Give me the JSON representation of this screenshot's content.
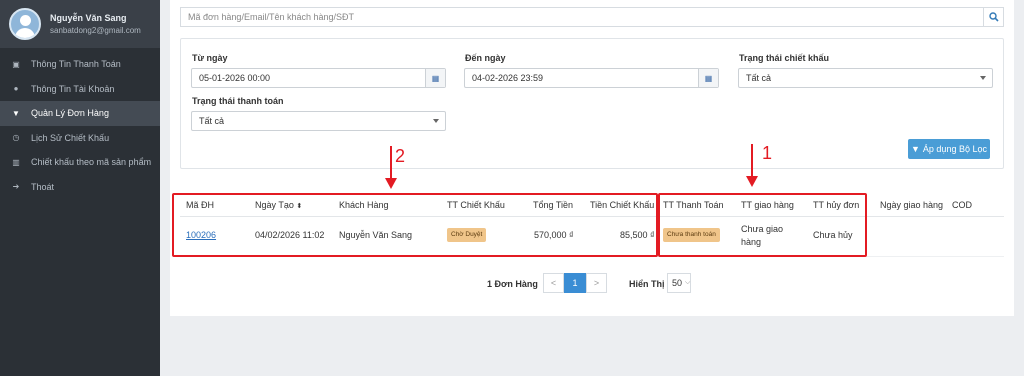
{
  "sidebar": {
    "user_name": "Nguyễn Văn Sang",
    "user_email": "sanbatdong2@gmail.com",
    "items": [
      {
        "label": "Thông Tin Thanh Toán",
        "icon": "money-icon"
      },
      {
        "label": "Thông Tin Tài Khoản",
        "icon": "user-icon"
      },
      {
        "label": "Quản Lý Đơn Hàng",
        "icon": "cart-icon"
      },
      {
        "label": "Lịch Sử Chiết Khấu",
        "icon": "clock-icon"
      },
      {
        "label": "Chiết khấu theo mã sản phẩm",
        "icon": "barcode-icon"
      },
      {
        "label": "Thoát",
        "icon": "sign-out-icon"
      }
    ],
    "active_index": 2
  },
  "search": {
    "placeholder": "Mã đơn hàng/Email/Tên khách hàng/SĐT"
  },
  "filters": {
    "from_label": "Từ ngày",
    "from_value": "05-01-2026 00:00",
    "to_label": "Đến ngày",
    "to_value": "04-02-2026 23:59",
    "discount_status_label": "Trạng thái chiết khấu",
    "discount_status_value": "Tất cả",
    "payment_status_label": "Trạng thái thanh toán",
    "payment_status_value": "Tất cả",
    "apply_label": "Áp dụng Bộ Lọc"
  },
  "table": {
    "columns": [
      "Mã ĐH",
      "Ngày Tạo",
      "Khách Hàng",
      "TT Chiết Khấu",
      "Tổng Tiền",
      "Tiền Chiết Khấu",
      "TT Thanh Toán",
      "TT giao hàng",
      "TT hủy đơn",
      "Ngày giao hàng",
      "COD"
    ],
    "rows": [
      {
        "order_id": "100206",
        "created": "04/02/2026 11:02",
        "customer": "Nguyễn Văn Sang",
        "discount_status": "Chờ Duyệt",
        "total": "570,000 ₫",
        "discount": "85,500 ₫",
        "payment_status": "Chưa thanh toán",
        "delivery_status_line1": "Chưa giao",
        "delivery_status_line2": "hàng",
        "cancel_status": "Chưa hủy"
      }
    ]
  },
  "pagination": {
    "count_label": "1 Đơn Hàng",
    "prev": "<",
    "current": "1",
    "next": ">",
    "show_label": "Hiển Thị",
    "page_size": "50"
  },
  "annotations": {
    "label_1": "1",
    "label_2": "2",
    "color": "#e31b23"
  }
}
